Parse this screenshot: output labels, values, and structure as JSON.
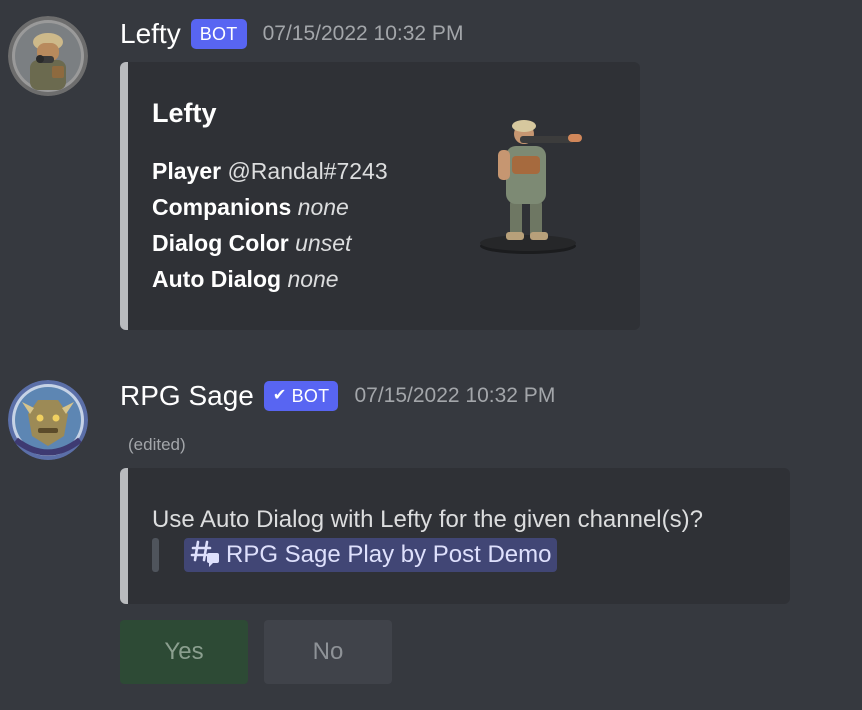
{
  "messages": [
    {
      "author": "Lefty",
      "badge": "BOT",
      "timestamp": "07/15/2022 10:32 PM",
      "embed": {
        "title": "Lefty",
        "fields": [
          {
            "name": "Player",
            "value": "@Randal#7243"
          },
          {
            "name": "Companions",
            "value": "none"
          },
          {
            "name": "Dialog Color",
            "value": "unset"
          },
          {
            "name": "Auto Dialog",
            "value": "none"
          }
        ],
        "border_color": "#b9bbbe"
      }
    },
    {
      "author": "RPG Sage",
      "badge": "BOT",
      "badge_verified": true,
      "timestamp": "07/15/2022 10:32 PM",
      "edited": "(edited)",
      "embed": {
        "description": "Use Auto Dialog with Lefty for the given channel(s)?",
        "channel": "RPG Sage Play by Post Demo"
      },
      "buttons": [
        {
          "label": "Yes",
          "style": "success",
          "disabled": true
        },
        {
          "label": "No",
          "style": "secondary",
          "disabled": true
        }
      ]
    }
  ],
  "colors": {
    "background": "#36393f",
    "embed_bg": "#2f3136",
    "blurple": "#5865f2",
    "mention_bg": "#414675"
  }
}
